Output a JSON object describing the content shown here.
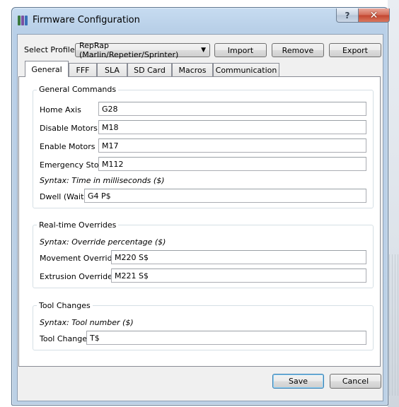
{
  "window": {
    "title": "Firmware Configuration",
    "help_glyph": "?",
    "close_glyph": "✕"
  },
  "toolbar": {
    "profile_label": "Select Profile:",
    "profile_value": "RepRap (Marlin/Repetier/Sprinter)",
    "import_label": "Import",
    "remove_label": "Remove",
    "export_label": "Export"
  },
  "tabs": [
    {
      "label": "General",
      "active": true
    },
    {
      "label": "FFF"
    },
    {
      "label": "SLA"
    },
    {
      "label": "SD Card"
    },
    {
      "label": "Macros"
    },
    {
      "label": "Communication"
    }
  ],
  "general_commands": {
    "title": "General Commands",
    "home_axis": {
      "label": "Home Axis",
      "value": "G28"
    },
    "disable_motors": {
      "label": "Disable Motors",
      "value": "M18"
    },
    "enable_motors": {
      "label": "Enable Motors",
      "value": "M17"
    },
    "emergency_stop": {
      "label": "Emergency Stop",
      "value": "M112"
    },
    "dwell_syntax": "Syntax: Time in milliseconds ($)",
    "dwell": {
      "label": "Dwell (Wait)",
      "value": "G4 P$"
    }
  },
  "realtime_overrides": {
    "title": "Real-time Overrides",
    "syntax": "Syntax: Override percentage ($)",
    "movement": {
      "label": "Movement Override",
      "value": "M220 S$"
    },
    "extrusion": {
      "label": "Extrusion Override",
      "value": "M221 S$"
    }
  },
  "tool_changes": {
    "title": "Tool Changes",
    "syntax": "Syntax: Tool number ($)",
    "tool_change": {
      "label": "Tool Change",
      "value": "T$"
    }
  },
  "footer": {
    "save_label": "Save",
    "cancel_label": "Cancel"
  },
  "colors": {
    "accent": "#3399ff",
    "close": "#c34530"
  }
}
